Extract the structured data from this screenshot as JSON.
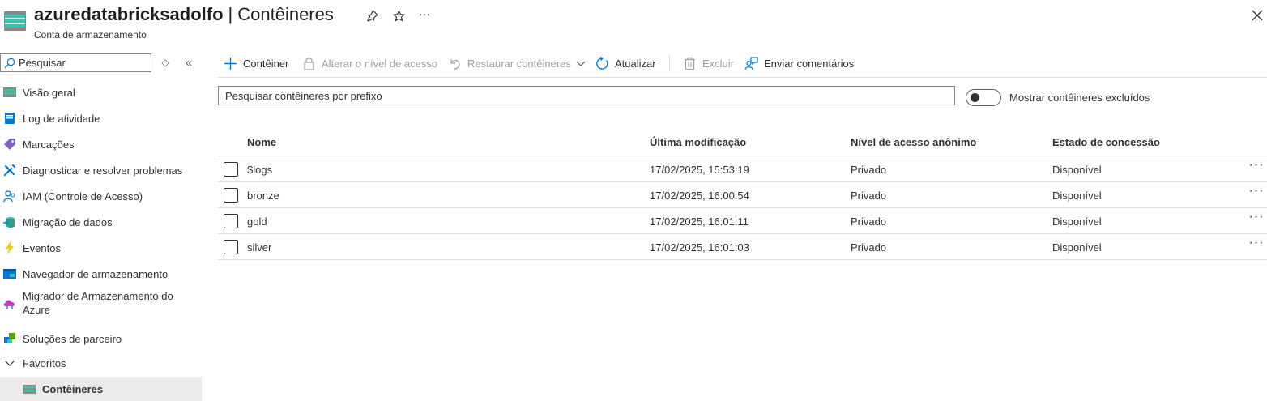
{
  "header": {
    "resource_name": "azuredatabricksadolfo",
    "separator": "|",
    "page_title": "Contêineres",
    "subtitle": "Conta de armazenamento",
    "more_glyph": "···"
  },
  "sidebar": {
    "search_placeholder": "Pesquisar",
    "collapse_glyph": "«",
    "updown_glyph": "◇",
    "items": [
      {
        "label": "Visão geral",
        "icon": "storage-overview-icon"
      },
      {
        "label": "Log de atividade",
        "icon": "activity-log-icon"
      },
      {
        "label": "Marcações",
        "icon": "tag-icon"
      },
      {
        "label": "Diagnosticar e resolver problemas",
        "icon": "wrench-icon"
      },
      {
        "label": "IAM (Controle de Acesso)",
        "icon": "people-icon"
      },
      {
        "label": "Migração de dados",
        "icon": "data-migration-icon"
      },
      {
        "label": "Eventos",
        "icon": "lightning-icon"
      },
      {
        "label": "Navegador de armazenamento",
        "icon": "storage-browser-icon"
      },
      {
        "label": "Migrador de Armazenamento do Azure",
        "icon": "cloud-migrator-icon"
      },
      {
        "label": "Soluções de parceiro",
        "icon": "partner-solutions-icon"
      },
      {
        "label": "Favoritos",
        "icon": "chevron-down-icon"
      },
      {
        "label": "Contêineres",
        "icon": "containers-icon"
      }
    ]
  },
  "toolbar": {
    "add_container": "Contêiner",
    "change_access": "Alterar o nível de acesso",
    "restore": "Restaurar contêineres",
    "refresh": "Atualizar",
    "delete": "Excluir",
    "feedback": "Enviar comentários"
  },
  "filter": {
    "prefix_placeholder": "Pesquisar contêineres por prefixo",
    "show_deleted_label": "Mostrar contêineres excluídos",
    "show_deleted_on": false
  },
  "table": {
    "columns": [
      "Nome",
      "Última modificação",
      "Nível de acesso anônimo",
      "Estado de concessão"
    ],
    "rows": [
      {
        "name": "$logs",
        "modified": "17/02/2025, 15:53:19",
        "access": "Privado",
        "lease": "Disponível"
      },
      {
        "name": "bronze",
        "modified": "17/02/2025, 16:00:54",
        "access": "Privado",
        "lease": "Disponível"
      },
      {
        "name": "gold",
        "modified": "17/02/2025, 16:01:11",
        "access": "Privado",
        "lease": "Disponível"
      },
      {
        "name": "silver",
        "modified": "17/02/2025, 16:01:03",
        "access": "Privado",
        "lease": "Disponível"
      }
    ],
    "row_menu_glyph": "···"
  },
  "colors": {
    "accent": "#0078d4",
    "container_teal": "#3fb0a0"
  }
}
